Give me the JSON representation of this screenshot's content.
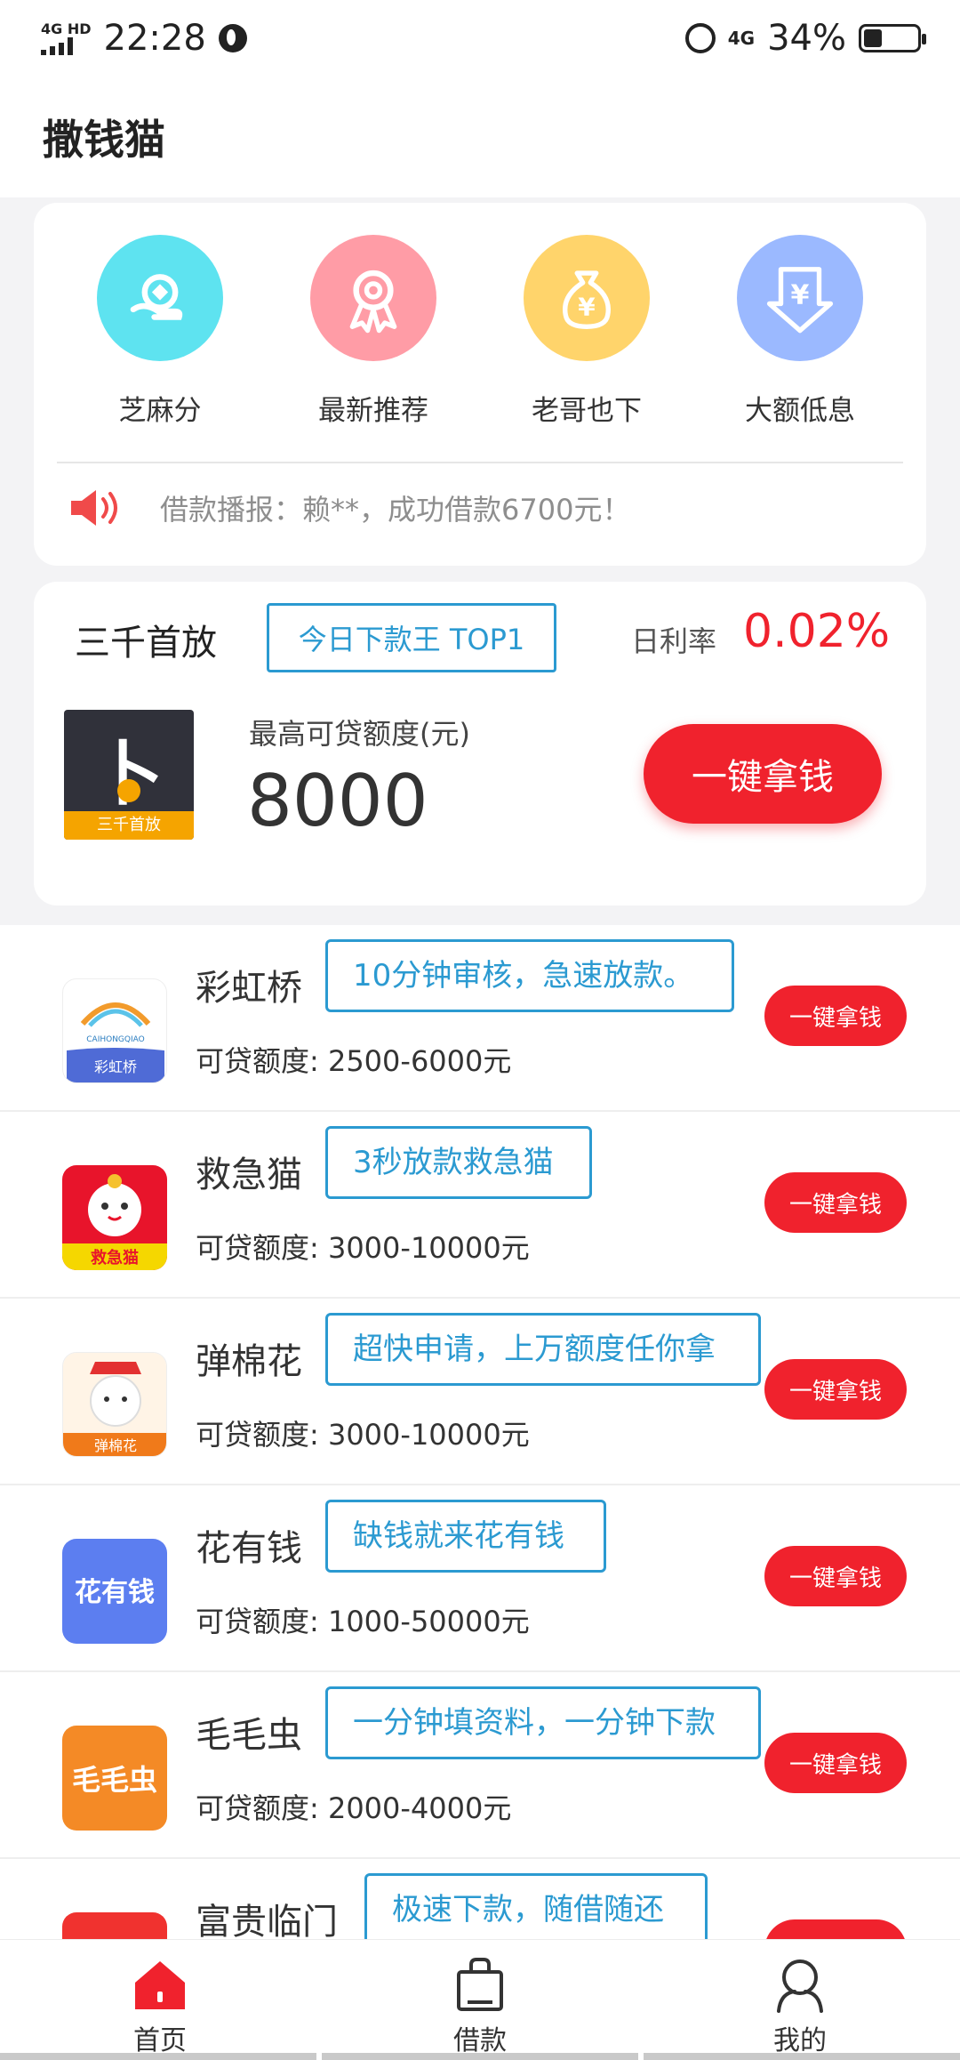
{
  "status_bar": {
    "network": "4G HD",
    "time": "22:28",
    "net_right": "4G",
    "battery": "34%",
    "battery_level": 0.34
  },
  "header": {
    "title": "撒钱猫"
  },
  "quick_entries": [
    {
      "label": "芝麻分",
      "color": "#5ee3f0",
      "icon": "coin-hand-icon"
    },
    {
      "label": "最新推荐",
      "color": "#ff9ca6",
      "icon": "ribbon-award-icon"
    },
    {
      "label": "老哥也下",
      "color": "#ffd46b",
      "icon": "money-bag-icon"
    },
    {
      "label": "大额低息",
      "color": "#9bb9ff",
      "icon": "yen-shield-icon"
    }
  ],
  "broadcast": {
    "text": "借款播报：赖**，成功借款6700元！",
    "icon": "speaker-icon"
  },
  "featured": {
    "name": "三千首放",
    "tag": "今日下款王 TOP1",
    "rate_label": "日利率",
    "rate": "0.02%",
    "logo_char": "⼘",
    "logo_band": "三千首放",
    "limit_label": "最高可贷额度(元)",
    "limit": "8000",
    "button": "一键拿钱"
  },
  "products": [
    {
      "name": "彩虹桥",
      "tag": "10分钟审核，急速放款。",
      "amount": "可贷额度: 2500-6000元",
      "button": "一键拿钱",
      "logo_text": "彩虹桥",
      "logo_sub": "CAIHONGQIAO"
    },
    {
      "name": "救急猫",
      "tag": "3秒放款救急猫",
      "amount": "可贷额度: 3000-10000元",
      "button": "一键拿钱",
      "logo_text": "救急猫"
    },
    {
      "name": "弹棉花",
      "tag": "超快申请，上万额度任你拿",
      "amount": "可贷额度: 3000-10000元",
      "button": "一键拿钱",
      "logo_text": "弹棉花"
    },
    {
      "name": "花有钱",
      "tag": "缺钱就来花有钱",
      "amount": "可贷额度: 1000-50000元",
      "button": "一键拿钱",
      "logo_text": "花有钱"
    },
    {
      "name": "毛毛虫",
      "tag": "一分钟填资料，一分钟下款",
      "amount": "可贷额度: 2000-4000元",
      "button": "一键拿钱",
      "logo_text": "毛毛虫"
    },
    {
      "name": "富贵临门",
      "tag": "极速下款，随借随还",
      "amount": "",
      "button": "",
      "logo_text": ""
    }
  ],
  "nav": [
    {
      "label": "首页",
      "icon": "home-icon",
      "active": true
    },
    {
      "label": "借款",
      "icon": "bag-icon",
      "active": false
    },
    {
      "label": "我的",
      "icon": "user-icon",
      "active": false
    }
  ]
}
